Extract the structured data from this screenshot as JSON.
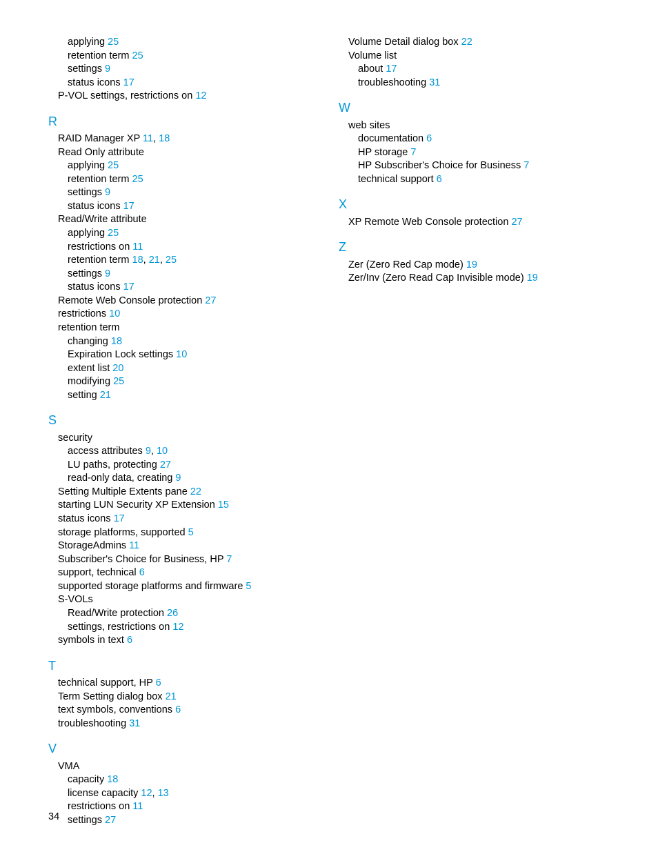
{
  "pageNumber": "34",
  "left": {
    "continued": [
      {
        "indent": 2,
        "text": "applying",
        "pages": [
          "25"
        ]
      },
      {
        "indent": 2,
        "text": "retention term",
        "pages": [
          "25"
        ]
      },
      {
        "indent": 2,
        "text": "settings",
        "pages": [
          "9"
        ]
      },
      {
        "indent": 2,
        "text": "status icons",
        "pages": [
          "17"
        ]
      },
      {
        "indent": 1,
        "text": "P-VOL settings, restrictions on",
        "pages": [
          "12"
        ]
      }
    ],
    "sections": [
      {
        "letter": "R",
        "entries": [
          {
            "indent": 1,
            "text": "RAID Manager XP",
            "pages": [
              "11",
              "18"
            ]
          },
          {
            "indent": 1,
            "text": "Read Only attribute",
            "pages": []
          },
          {
            "indent": 2,
            "text": "applying",
            "pages": [
              "25"
            ]
          },
          {
            "indent": 2,
            "text": "retention term",
            "pages": [
              "25"
            ]
          },
          {
            "indent": 2,
            "text": "settings",
            "pages": [
              "9"
            ]
          },
          {
            "indent": 2,
            "text": "status icons",
            "pages": [
              "17"
            ]
          },
          {
            "indent": 1,
            "text": "Read/Write attribute",
            "pages": []
          },
          {
            "indent": 2,
            "text": "applying",
            "pages": [
              "25"
            ]
          },
          {
            "indent": 2,
            "text": "restrictions on",
            "pages": [
              "11"
            ]
          },
          {
            "indent": 2,
            "text": "retention term",
            "pages": [
              "18",
              "21",
              "25"
            ]
          },
          {
            "indent": 2,
            "text": "settings",
            "pages": [
              "9"
            ]
          },
          {
            "indent": 2,
            "text": "status icons",
            "pages": [
              "17"
            ]
          },
          {
            "indent": 1,
            "text": "Remote Web Console protection",
            "pages": [
              "27"
            ]
          },
          {
            "indent": 1,
            "text": "restrictions",
            "pages": [
              "10"
            ]
          },
          {
            "indent": 1,
            "text": "retention term",
            "pages": []
          },
          {
            "indent": 2,
            "text": "changing",
            "pages": [
              "18"
            ]
          },
          {
            "indent": 2,
            "text": "Expiration Lock settings",
            "pages": [
              "10"
            ]
          },
          {
            "indent": 2,
            "text": "extent list",
            "pages": [
              "20"
            ]
          },
          {
            "indent": 2,
            "text": "modifying",
            "pages": [
              "25"
            ]
          },
          {
            "indent": 2,
            "text": "setting",
            "pages": [
              "21"
            ]
          }
        ]
      },
      {
        "letter": "S",
        "entries": [
          {
            "indent": 1,
            "text": "security",
            "pages": []
          },
          {
            "indent": 2,
            "text": "access attributes",
            "pages": [
              "9",
              "10"
            ]
          },
          {
            "indent": 2,
            "text": "LU paths, protecting",
            "pages": [
              "27"
            ]
          },
          {
            "indent": 2,
            "text": "read-only data, creating",
            "pages": [
              "9"
            ]
          },
          {
            "indent": 1,
            "text": "Setting Multiple Extents pane",
            "pages": [
              "22"
            ]
          },
          {
            "indent": 1,
            "text": "starting LUN Security XP Extension",
            "pages": [
              "15"
            ]
          },
          {
            "indent": 1,
            "text": "status icons",
            "pages": [
              "17"
            ]
          },
          {
            "indent": 1,
            "text": "storage platforms, supported",
            "pages": [
              "5"
            ]
          },
          {
            "indent": 1,
            "text": "StorageAdmins",
            "pages": [
              "11"
            ]
          },
          {
            "indent": 1,
            "text": "Subscriber's Choice for Business, HP",
            "pages": [
              "7"
            ]
          },
          {
            "indent": 1,
            "text": "support, technical",
            "pages": [
              "6"
            ]
          },
          {
            "indent": 1,
            "text": "supported storage platforms and firmware",
            "pages": [
              "5"
            ]
          },
          {
            "indent": 1,
            "text": "S-VOLs",
            "pages": []
          },
          {
            "indent": 2,
            "text": "Read/Write protection",
            "pages": [
              "26"
            ]
          },
          {
            "indent": 2,
            "text": "settings, restrictions on",
            "pages": [
              "12"
            ]
          },
          {
            "indent": 1,
            "text": "symbols in text",
            "pages": [
              "6"
            ]
          }
        ]
      },
      {
        "letter": "T",
        "entries": [
          {
            "indent": 1,
            "text": "technical support, HP",
            "pages": [
              "6"
            ]
          },
          {
            "indent": 1,
            "text": "Term Setting dialog box",
            "pages": [
              "21"
            ]
          },
          {
            "indent": 1,
            "text": "text symbols, conventions",
            "pages": [
              "6"
            ]
          },
          {
            "indent": 1,
            "text": "troubleshooting",
            "pages": [
              "31"
            ]
          }
        ]
      },
      {
        "letter": "V",
        "entries": [
          {
            "indent": 1,
            "text": "VMA",
            "pages": []
          },
          {
            "indent": 2,
            "text": "capacity",
            "pages": [
              "18"
            ]
          },
          {
            "indent": 2,
            "text": "license capacity",
            "pages": [
              "12",
              "13"
            ]
          },
          {
            "indent": 2,
            "text": "restrictions on",
            "pages": [
              "11"
            ]
          },
          {
            "indent": 2,
            "text": "settings",
            "pages": [
              "27"
            ]
          }
        ]
      }
    ]
  },
  "right": {
    "continued": [
      {
        "indent": 1,
        "text": "Volume Detail dialog box",
        "pages": [
          "22"
        ]
      },
      {
        "indent": 1,
        "text": "Volume list",
        "pages": []
      },
      {
        "indent": 2,
        "text": "about",
        "pages": [
          "17"
        ]
      },
      {
        "indent": 2,
        "text": "troubleshooting",
        "pages": [
          "31"
        ]
      }
    ],
    "sections": [
      {
        "letter": "W",
        "entries": [
          {
            "indent": 1,
            "text": "web sites",
            "pages": []
          },
          {
            "indent": 2,
            "text": "documentation",
            "pages": [
              "6"
            ]
          },
          {
            "indent": 2,
            "text": "HP storage",
            "pages": [
              "7"
            ]
          },
          {
            "indent": 2,
            "text": "HP Subscriber's Choice for Business",
            "pages": [
              "7"
            ]
          },
          {
            "indent": 2,
            "text": "technical support",
            "pages": [
              "6"
            ]
          }
        ]
      },
      {
        "letter": "X",
        "entries": [
          {
            "indent": 1,
            "text": "XP Remote Web Console protection",
            "pages": [
              "27"
            ]
          }
        ]
      },
      {
        "letter": "Z",
        "entries": [
          {
            "indent": 1,
            "text": "Zer (Zero Red Cap mode)",
            "pages": [
              "19"
            ]
          },
          {
            "indent": 1,
            "text": "Zer/Inv (Zero Read Cap Invisible mode)",
            "pages": [
              "19"
            ]
          }
        ]
      }
    ]
  }
}
